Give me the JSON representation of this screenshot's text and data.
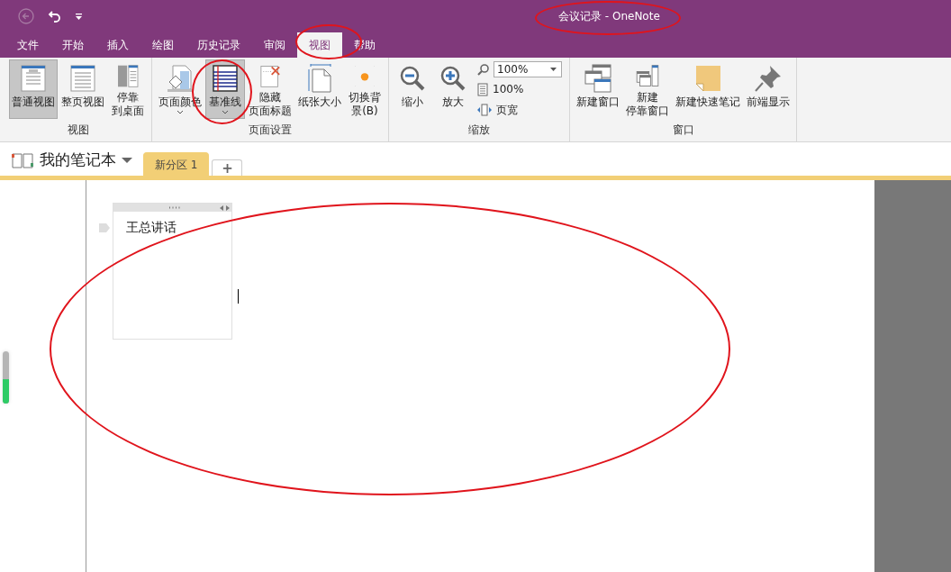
{
  "window": {
    "title": "会议记录 - OneNote"
  },
  "menu_tabs": [
    {
      "label": "文件",
      "selected": false
    },
    {
      "label": "开始",
      "selected": false
    },
    {
      "label": "插入",
      "selected": false
    },
    {
      "label": "绘图",
      "selected": false
    },
    {
      "label": "历史记录",
      "selected": false
    },
    {
      "label": "审阅",
      "selected": false
    },
    {
      "label": "视图",
      "selected": true
    },
    {
      "label": "帮助",
      "selected": false
    }
  ],
  "ribbon": {
    "groups": [
      {
        "label": "视图",
        "items": [
          {
            "kind": "large",
            "label": "普通视图",
            "selected": true
          },
          {
            "kind": "large",
            "label": "整页视图",
            "selected": false
          },
          {
            "kind": "large",
            "label_lines": [
              "停靠",
              "到桌面"
            ],
            "selected": false
          }
        ]
      },
      {
        "label": "页面设置",
        "items": [
          {
            "kind": "large",
            "label": "页面颜色",
            "selected": false,
            "dropdown": true
          },
          {
            "kind": "large",
            "label": "基准线",
            "selected": true,
            "dropdown": true
          },
          {
            "kind": "large",
            "label_lines": [
              "隐藏",
              "页面标题"
            ],
            "selected": false
          },
          {
            "kind": "large",
            "label": "纸张大小",
            "selected": false
          },
          {
            "kind": "large",
            "label_lines": [
              "切换背",
              "景(B)"
            ],
            "selected": false
          }
        ]
      },
      {
        "label": "缩放",
        "items": [
          {
            "kind": "large",
            "label": "缩小",
            "selected": false
          },
          {
            "kind": "large",
            "label": "放大",
            "selected": false
          },
          {
            "kind": "stack",
            "rows": [
              {
                "kind": "combo",
                "value": "100%"
              },
              {
                "kind": "small",
                "label": "100%"
              },
              {
                "kind": "small",
                "label": "页宽"
              }
            ]
          }
        ]
      },
      {
        "label": "窗口",
        "items": [
          {
            "kind": "large",
            "label": "新建窗口",
            "selected": false
          },
          {
            "kind": "large",
            "label_lines": [
              "新建",
              "停靠窗口"
            ],
            "selected": false
          },
          {
            "kind": "large",
            "label": "新建快速笔记",
            "selected": false
          },
          {
            "kind": "large",
            "label": "前端显示",
            "selected": false
          }
        ]
      }
    ]
  },
  "notebook": {
    "name": "我的笔记本",
    "sections": [
      {
        "label": "新分区 1",
        "selected": true,
        "color": "#f2cf76"
      }
    ],
    "add_tab": "+"
  },
  "page": {
    "note_text": "王总讲话",
    "side_meter": {
      "level": 0.47
    }
  }
}
